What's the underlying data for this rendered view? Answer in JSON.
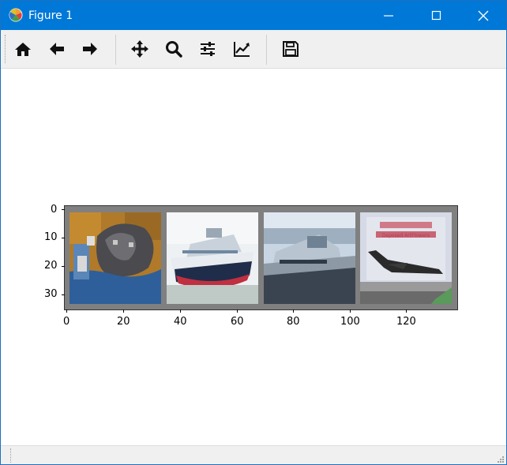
{
  "window": {
    "title": "Figure 1",
    "app_icon": "matplotlib-icon",
    "controls": [
      "minimize-icon",
      "maximize-icon",
      "close-icon"
    ]
  },
  "toolbar": {
    "buttons": [
      {
        "name": "home",
        "icon": "home-icon"
      },
      {
        "name": "back",
        "icon": "arrow-left-icon"
      },
      {
        "name": "forward",
        "icon": "arrow-right-icon"
      },
      {
        "name": "pan",
        "icon": "move-icon"
      },
      {
        "name": "zoom",
        "icon": "zoom-icon"
      },
      {
        "name": "configure-subplots",
        "icon": "sliders-icon"
      },
      {
        "name": "edit-axes",
        "icon": "chart-line-icon"
      },
      {
        "name": "save",
        "icon": "save-icon"
      }
    ]
  },
  "figure": {
    "y_ticks": [
      "0",
      "10",
      "20",
      "30"
    ],
    "x_ticks": [
      "0",
      "20",
      "40",
      "60",
      "80",
      "100",
      "120"
    ],
    "images": [
      {
        "subject": "cat"
      },
      {
        "subject": "ship"
      },
      {
        "subject": "ship"
      },
      {
        "subject": "airplane"
      }
    ],
    "airplane_text": "Deposed ArtFlowers"
  },
  "colors": {
    "titlebar": "#0078d7",
    "toolbar": "#f0f0f0",
    "image_border": "#808080"
  }
}
